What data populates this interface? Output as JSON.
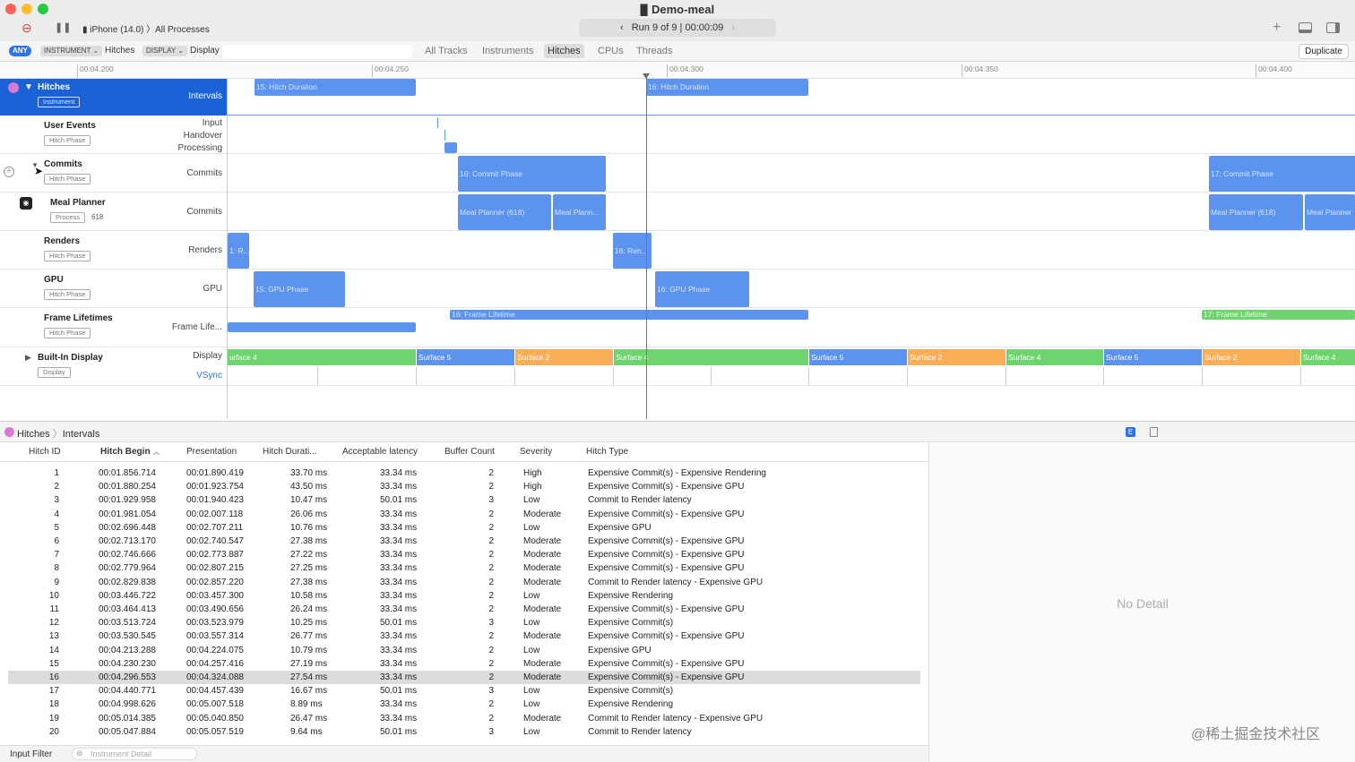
{
  "window": {
    "title": "Demo-meal",
    "device": "iPhone (14.0)",
    "target": "All Processes",
    "run": "Run 9 of 9",
    "elapsed": "00:00:09"
  },
  "filterbar": {
    "any": "ANY",
    "instrument_chip": "INSTRUMENT",
    "instrument_value": "Hitches",
    "display_chip": "DISPLAY",
    "display_value": "Display",
    "segments": [
      "All Tracks",
      "Instruments",
      "Hitches",
      "CPUs",
      "Threads"
    ],
    "selected_segment": "Hitches",
    "duplicate": "Duplicate"
  },
  "ruler": [
    "00:04.200",
    "00:04.250",
    "00:04.300",
    "00:04.350",
    "00:04.400"
  ],
  "tracks": {
    "hitches": {
      "name": "Hitches",
      "badge": "Instrument",
      "sub": "Intervals",
      "bars": [
        "15: Hitch Duration",
        "16: Hitch Duration"
      ]
    },
    "user_events": {
      "name": "User Events",
      "badge": "Hitch Phase",
      "subs": [
        "Input",
        "Handover",
        "Processing"
      ]
    },
    "commits": {
      "name": "Commits",
      "badge": "Hitch Phase",
      "sub": "Commits",
      "bars": [
        "16: Commit Phase",
        "17: Commit Phase"
      ]
    },
    "meal_planner": {
      "name": "Meal Planner",
      "badge": "Process",
      "pid": "618",
      "sub": "Commits",
      "bars": [
        "Meal Planner (618)",
        "Meal Plann...",
        "Meal Planner (618)",
        "Meal Planner"
      ]
    },
    "renders": {
      "name": "Renders",
      "badge": "Hitch Phase",
      "sub": "Renders",
      "bars": [
        "1: R...",
        "16: Ren..."
      ]
    },
    "gpu": {
      "name": "GPU",
      "badge": "Hitch Phase",
      "sub": "GPU",
      "bars": [
        "15: GPU Phase",
        "16: GPU Phase"
      ]
    },
    "frame_lifetimes": {
      "name": "Frame Lifetimes",
      "badge": "Hitch Phase",
      "sub": "Frame Life...",
      "bars": [
        "16: Frame Lifetime",
        "17: Frame Lifetime"
      ]
    },
    "display": {
      "name": "Built-In Display",
      "badge": "Display",
      "sub": "Display",
      "sub2": "VSync",
      "surfaces": [
        "urface 4",
        "Surface 5",
        "Surface 2",
        "Surface 4",
        "Surface 5",
        "Surface 2",
        "Surface 4",
        "Surface 5",
        "Surface 2",
        "Surface 4"
      ]
    }
  },
  "detail": {
    "breadcrumb_1": "Hitches",
    "breadcrumb_2": "Intervals",
    "no_detail": "No Detail",
    "input_filter": "Input Filter",
    "instrument_detail": "Instrument Detail"
  },
  "table": {
    "columns": [
      "Hitch ID",
      "Hitch Begin",
      "Presentation",
      "Hitch Durati...",
      "Acceptable latency",
      "Buffer Count",
      "Severity",
      "Hitch Type"
    ],
    "rows": [
      [
        "1",
        "00:01.856.714",
        "00:01.890.419",
        "33.70 ms",
        "33.34 ms",
        "2",
        "High",
        "Expensive Commit(s) - Expensive Rendering"
      ],
      [
        "2",
        "00:01.880.254",
        "00:01.923.754",
        "43.50 ms",
        "33.34 ms",
        "2",
        "High",
        "Expensive Commit(s) - Expensive GPU"
      ],
      [
        "3",
        "00:01.929.958",
        "00:01.940.423",
        "10.47 ms",
        "50.01 ms",
        "3",
        "Low",
        "Commit to Render latency"
      ],
      [
        "4",
        "00:01.981.054",
        "00:02.007.118",
        "26.06 ms",
        "33.34 ms",
        "2",
        "Moderate",
        "Expensive Commit(s) - Expensive GPU"
      ],
      [
        "5",
        "00:02.696.448",
        "00:02.707.211",
        "10.76 ms",
        "33.34 ms",
        "2",
        "Low",
        "Expensive GPU"
      ],
      [
        "6",
        "00:02.713.170",
        "00:02.740.547",
        "27.38 ms",
        "33.34 ms",
        "2",
        "Moderate",
        "Expensive Commit(s) - Expensive GPU"
      ],
      [
        "7",
        "00:02.746.666",
        "00:02.773.887",
        "27.22 ms",
        "33.34 ms",
        "2",
        "Moderate",
        "Expensive Commit(s) - Expensive GPU"
      ],
      [
        "8",
        "00:02.779.964",
        "00:02.807.215",
        "27.25 ms",
        "33.34 ms",
        "2",
        "Moderate",
        "Expensive Commit(s) - Expensive GPU"
      ],
      [
        "9",
        "00:02.829.838",
        "00:02.857.220",
        "27.38 ms",
        "33.34 ms",
        "2",
        "Moderate",
        "Commit to Render latency - Expensive GPU"
      ],
      [
        "10",
        "00:03.446.722",
        "00:03.457.300",
        "10.58 ms",
        "33.34 ms",
        "2",
        "Low",
        "Expensive Rendering"
      ],
      [
        "11",
        "00:03.464.413",
        "00:03.490.656",
        "26.24 ms",
        "33.34 ms",
        "2",
        "Moderate",
        "Expensive Commit(s) - Expensive GPU"
      ],
      [
        "12",
        "00:03.513.724",
        "00:03.523.979",
        "10.25 ms",
        "50.01 ms",
        "3",
        "Low",
        "Expensive Commit(s)"
      ],
      [
        "13",
        "00:03.530.545",
        "00:03.557.314",
        "26.77 ms",
        "33.34 ms",
        "2",
        "Moderate",
        "Expensive Commit(s) - Expensive GPU"
      ],
      [
        "14",
        "00:04.213.288",
        "00:04.224.075",
        "10.79 ms",
        "33.34 ms",
        "2",
        "Low",
        "Expensive GPU"
      ],
      [
        "15",
        "00:04.230.230",
        "00:04.257.416",
        "27.19 ms",
        "33.34 ms",
        "2",
        "Moderate",
        "Expensive Commit(s) - Expensive GPU"
      ],
      [
        "16",
        "00:04.296.553",
        "00:04.324.088",
        "27.54 ms",
        "33.34 ms",
        "2",
        "Moderate",
        "Expensive Commit(s) - Expensive GPU"
      ],
      [
        "17",
        "00:04.440.771",
        "00:04.457.439",
        "16.67 ms",
        "50.01 ms",
        "3",
        "Low",
        "Expensive Commit(s)"
      ],
      [
        "18",
        "00:04.998.626",
        "00:05.007.518",
        "8.89 ms",
        "33.34 ms",
        "2",
        "Low",
        "Expensive Rendering"
      ],
      [
        "19",
        "00:05.014.385",
        "00:05.040.850",
        "26.47 ms",
        "33.34 ms",
        "2",
        "Moderate",
        "Commit to Render latency - Expensive GPU"
      ],
      [
        "20",
        "00:05.047.884",
        "00:05.057.519",
        "9.64 ms",
        "50.01 ms",
        "3",
        "Low",
        "Commit to Render latency"
      ]
    ],
    "selected_row": 16
  },
  "watermark": "@稀土掘金技术社区"
}
